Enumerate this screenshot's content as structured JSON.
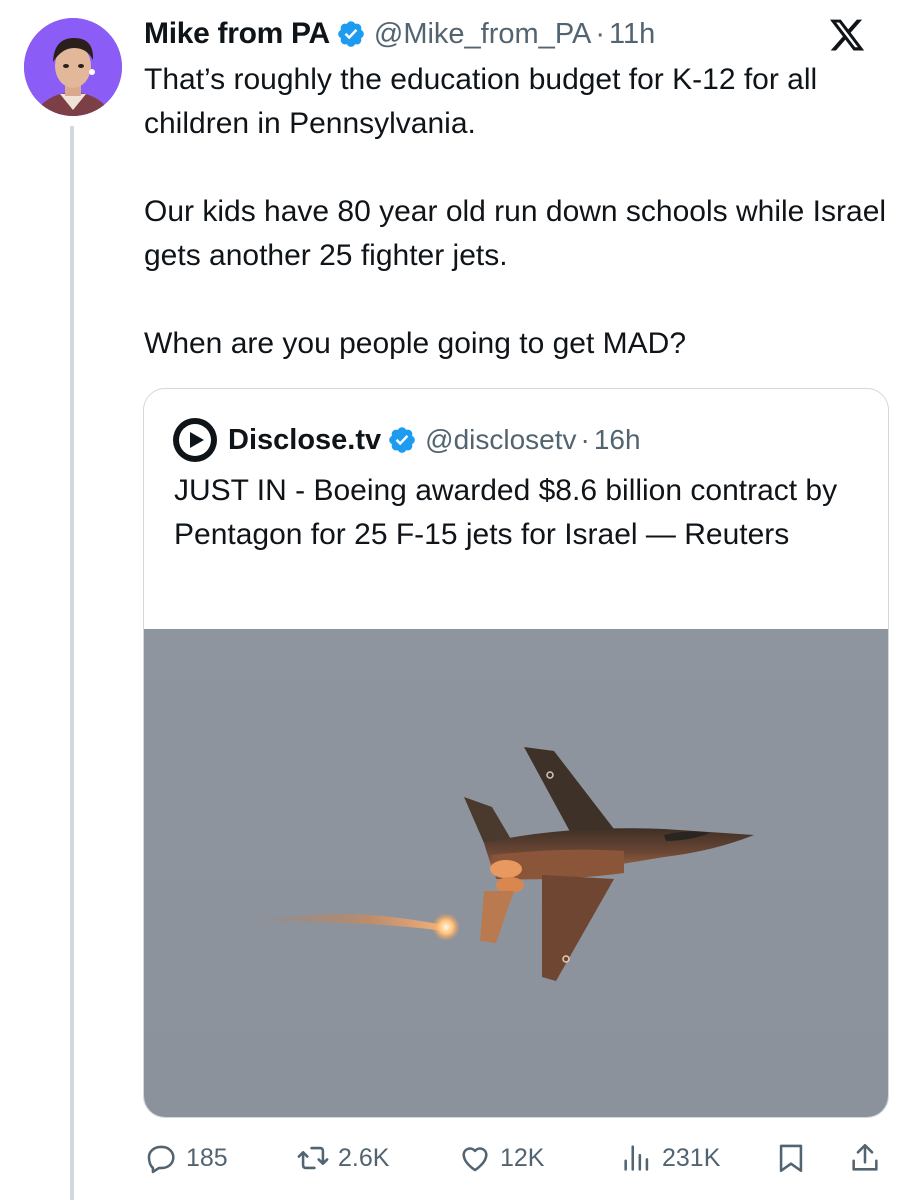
{
  "tweet": {
    "author": {
      "display_name": "Mike from PA",
      "handle": "@Mike_from_PA",
      "verified": true,
      "verified_color": "#1d9bf0"
    },
    "time_ago": "11h",
    "separator": "·",
    "paragraphs": [
      "That’s roughly the education budget for K-12 for all children in Pennsylvania.",
      "Our kids have 80 year old run down schools while Israel gets another 25 fighter jets.",
      "When are you people going to get MAD?"
    ],
    "platform_icon": "x-logo-icon"
  },
  "quoted": {
    "author": {
      "display_name": "Disclose.tv",
      "handle": "@disclosetv",
      "verified": true
    },
    "time_ago": "16h",
    "separator": "·",
    "text": "JUST IN - Boeing awarded $8.6 billion contract by Pentagon for 25 F-15 jets for Israel — Reuters",
    "media_icon": "fighter-jet-photo"
  },
  "actions": {
    "reply_count": "185",
    "retweet_count": "2.6K",
    "like_count": "12K",
    "view_count": "231K"
  },
  "colors": {
    "text_primary": "#0f1419",
    "text_secondary": "#536471",
    "border": "#cfd9de",
    "accent": "#1d9bf0",
    "avatar_bg": "#8b5cf6",
    "sky": "#8e959f"
  }
}
